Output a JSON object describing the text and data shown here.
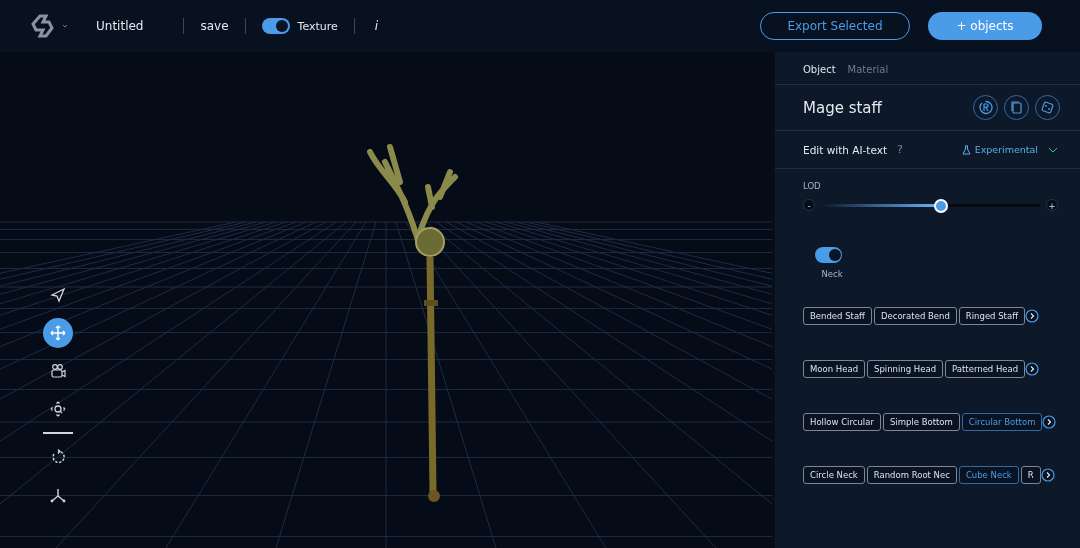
{
  "header": {
    "project": "Untitled",
    "save": "save",
    "texture": {
      "label": "Texture",
      "on": true
    },
    "info": "i",
    "export": "Export Selected",
    "add": "+ objects"
  },
  "tools": [
    {
      "kind": "select",
      "selected": false
    },
    {
      "kind": "move",
      "selected": true
    },
    {
      "kind": "camera",
      "selected": false
    },
    {
      "kind": "zoom",
      "selected": false
    },
    {
      "kind": "rotate",
      "selected": false
    },
    {
      "kind": "axes",
      "selected": false
    }
  ],
  "panel": {
    "tabs": [
      {
        "label": "Object",
        "selected": true
      },
      {
        "label": "Material",
        "selected": false
      }
    ],
    "name": "Mage staff",
    "ai_text": "Edit with AI-text",
    "help": "?",
    "mode": "Experimental",
    "lod": {
      "label": "LOD",
      "level": 0.55,
      "minus": "-",
      "plus": "+"
    },
    "neck": {
      "label": "Neck",
      "on": true
    },
    "rows": [
      {
        "chips": [
          {
            "label": "Bended Staff",
            "selected": false
          },
          {
            "label": "Decorated Bend",
            "selected": false
          },
          {
            "label": "Ringed Staff",
            "selected": false
          }
        ]
      },
      {
        "chips": [
          {
            "label": "Moon Head",
            "selected": false
          },
          {
            "label": "Spinning Head",
            "selected": false
          },
          {
            "label": "Patterned Head",
            "selected": false
          }
        ]
      },
      {
        "chips": [
          {
            "label": "Hollow Circular",
            "selected": false
          },
          {
            "label": "Simple Bottom",
            "selected": false
          },
          {
            "label": "Circular Bottom",
            "selected": true
          }
        ]
      },
      {
        "chips": [
          {
            "label": "Circle Neck",
            "selected": false
          },
          {
            "label": "Random Root Nec",
            "selected": false
          },
          {
            "label": "Cube Neck",
            "selected": true
          },
          {
            "label": "R",
            "selected": false
          }
        ]
      }
    ]
  }
}
